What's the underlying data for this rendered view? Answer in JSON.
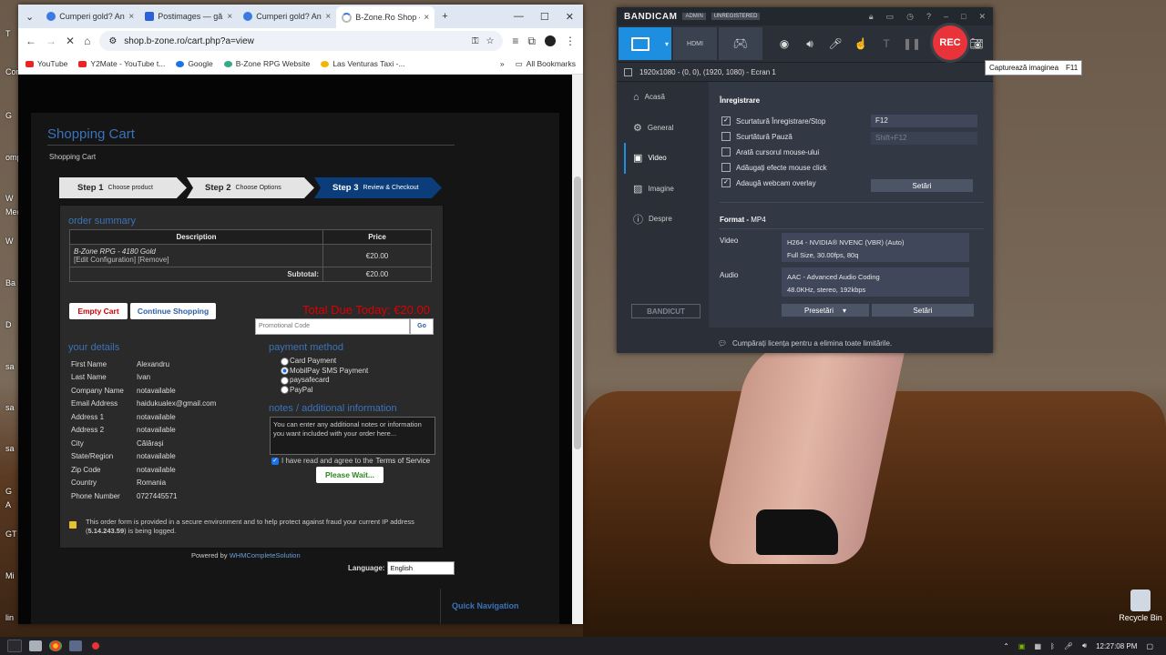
{
  "desktop": {
    "icon_labels": [
      "T",
      "Con",
      "G",
      "omp",
      "W",
      "Med",
      "W",
      "Ba",
      "D",
      "sa",
      "sa",
      "sa",
      "G",
      "A",
      "GT",
      "Mi",
      "lin"
    ],
    "recycle_bin": "Recycle Bin"
  },
  "chrome": {
    "tabs": [
      {
        "title": "Cumperi gold? An"
      },
      {
        "title": "Postimages — gă"
      },
      {
        "title": "Cumperi gold? An"
      },
      {
        "title": "B-Zone.Ro Shop -"
      }
    ],
    "new_tab": "+",
    "url": "shop.b-zone.ro/cart.php?a=view",
    "bookmarks": [
      "YouTube",
      "Y2Mate - YouTube t...",
      "Google",
      "B-Zone RPG Website",
      "Las Venturas Taxi -..."
    ],
    "all_bookmarks": "All Bookmarks"
  },
  "page": {
    "title": "Shopping Cart",
    "breadcrumb": "Shopping Cart",
    "steps": [
      {
        "num": "Step 1",
        "label": "Choose product"
      },
      {
        "num": "Step 2",
        "label": "Choose Options"
      },
      {
        "num": "Step 3",
        "label": "Review & Checkout"
      }
    ],
    "order_summary": "order summary",
    "table": {
      "col_desc": "Description",
      "col_price": "Price",
      "item_name": "B-Zone RPG - 4180 Gold",
      "item_links": "[Edit Configuration] [Remove]",
      "item_price": "€20.00",
      "subtotal_label": "Subtotal:",
      "subtotal_value": "€20.00"
    },
    "empty_cart": "Empty Cart",
    "continue_shopping": "Continue Shopping",
    "total_due": "Total Due Today: €20.00",
    "promo_placeholder": "Promotional Code",
    "go": "Go",
    "your_details": "your details",
    "details": [
      {
        "k": "First Name",
        "v": "Alexandru"
      },
      {
        "k": "Last Name",
        "v": "Ivan"
      },
      {
        "k": "Company Name",
        "v": "notavailable"
      },
      {
        "k": "Email Address",
        "v": "haidukualex@gmail.com"
      },
      {
        "k": "Address 1",
        "v": "notavailable"
      },
      {
        "k": "Address 2",
        "v": "notavailable"
      },
      {
        "k": "City",
        "v": "Călărași"
      },
      {
        "k": "State/Region",
        "v": "notavailable"
      },
      {
        "k": "Zip Code",
        "v": "notavailable"
      },
      {
        "k": "Country",
        "v": "Romania"
      },
      {
        "k": "Phone Number",
        "v": "0727445571"
      }
    ],
    "payment_method": "payment method",
    "payments": [
      "Card Payment",
      "MobilPay SMS Payment",
      "paysafecard",
      "PayPal"
    ],
    "payment_selected": 1,
    "notes_title": "notes / additional information",
    "notes_text": "You can enter any additional notes or information you want included with your order here...",
    "tos_prefix": "I have read and agree to the ",
    "tos_link": "Terms of Service",
    "please_wait": "Please Wait...",
    "secure_text_1": "This order form is provided in a secure environment and to help protect against fraud your current IP address (",
    "secure_ip": "5.14.243.59",
    "secure_text_2": ") is being logged.",
    "powered_prefix": "Powered by ",
    "powered_link": "WHMCompleteSolution",
    "language_label": "Language:",
    "language_value": "English",
    "quick_nav": "Quick Navigation"
  },
  "bandicam": {
    "logo": "BANDICAM",
    "badge_admin": "ADMIN",
    "badge_unreg": "UNREGISTERED",
    "rec": "REC",
    "resolution": "1920x1080 - (0, 0), (1920, 1080) - Ecran 1",
    "nav": [
      "Acasă",
      "General",
      "Video",
      "Imagine",
      "Despre"
    ],
    "nav_selected": 2,
    "bandicut": "BANDICUT",
    "section_record": "Înregistrare",
    "options": [
      {
        "label": "Scurtatură Înregistrare/Stop",
        "checked": true
      },
      {
        "label": "Scurtătură Pauză",
        "checked": false
      },
      {
        "label": "Arată cursorul mouse-ului",
        "checked": false
      },
      {
        "label": "Adăugați efecte mouse click",
        "checked": false
      },
      {
        "label": "Adaugă webcam overlay",
        "checked": true
      }
    ],
    "hotkey_record": "F12",
    "hotkey_pause": "Shift+F12",
    "settings_btn": "Setări",
    "format_label": "Format",
    "format_value": "MP4",
    "video_label": "Video",
    "video_line1": "H264 - NVIDIA® NVENC (VBR) (Auto)",
    "video_line2": "Full Size, 30.00fps, 80q",
    "audio_label": "Audio",
    "audio_line1": "AAC - Advanced Audio Coding",
    "audio_line2": "48.0KHz, stereo, 192kbps",
    "presets_btn": "Presetări",
    "settings_btn2": "Setări",
    "footer": "Cumpărați licența pentru a elimina toate limitările.",
    "tooltip_label": "Capturează imaginea",
    "tooltip_key": "F11"
  },
  "taskbar": {
    "time": "12:27:08 PM"
  }
}
